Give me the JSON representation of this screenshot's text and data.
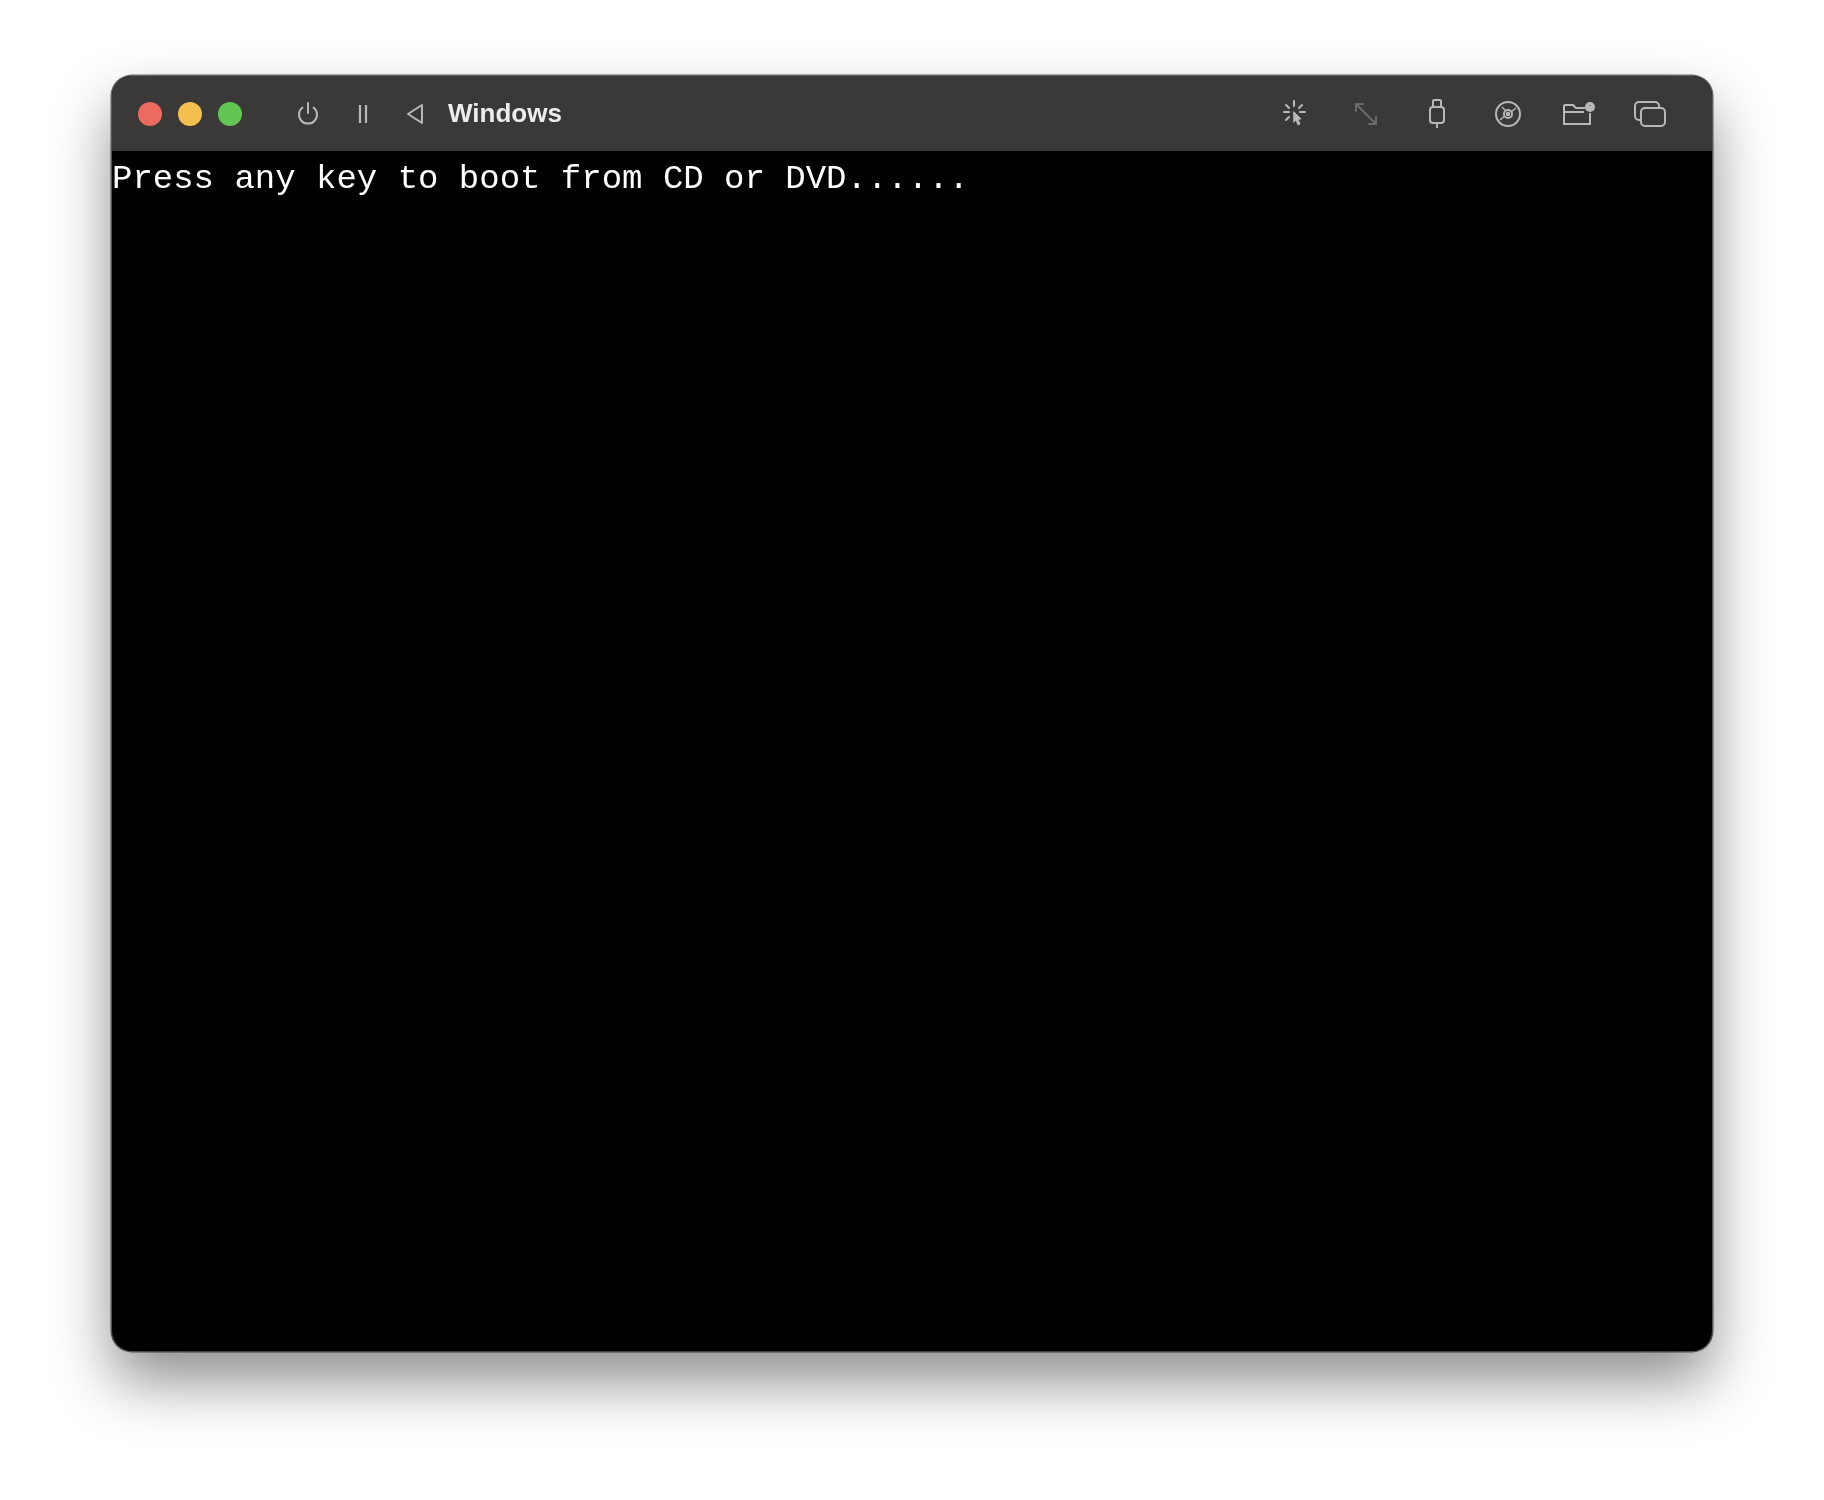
{
  "window": {
    "title": "Windows"
  },
  "traffic_lights": [
    {
      "color": "#ec6a5e"
    },
    {
      "color": "#f4bf4f"
    },
    {
      "color": "#61c554"
    }
  ],
  "left_controls": [
    {
      "kind": "power",
      "disabled": false
    },
    {
      "kind": "pause",
      "disabled": false
    },
    {
      "kind": "back",
      "disabled": false
    }
  ],
  "right_controls": [
    {
      "kind": "capture",
      "disabled": false
    },
    {
      "kind": "resize",
      "disabled": true
    },
    {
      "kind": "usb",
      "disabled": false
    },
    {
      "kind": "disc",
      "disabled": false
    },
    {
      "kind": "shared-folder",
      "disabled": false
    },
    {
      "kind": "windows",
      "disabled": false
    }
  ],
  "console": {
    "lines": [
      "Press any key to boot from CD or DVD......"
    ]
  }
}
